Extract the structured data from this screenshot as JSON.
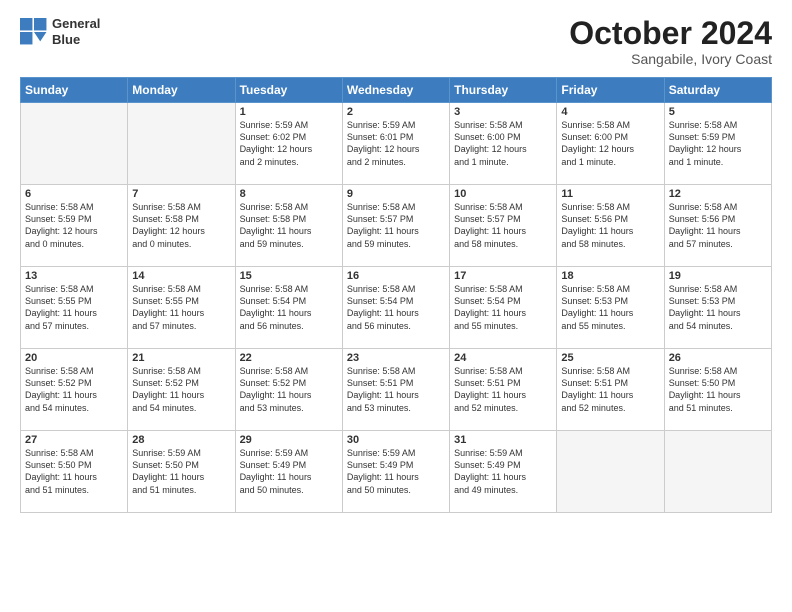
{
  "header": {
    "logo_line1": "General",
    "logo_line2": "Blue",
    "month_title": "October 2024",
    "subtitle": "Sangabile, Ivory Coast"
  },
  "weekdays": [
    "Sunday",
    "Monday",
    "Tuesday",
    "Wednesday",
    "Thursday",
    "Friday",
    "Saturday"
  ],
  "weeks": [
    [
      {
        "day": "",
        "info": ""
      },
      {
        "day": "",
        "info": ""
      },
      {
        "day": "1",
        "info": "Sunrise: 5:59 AM\nSunset: 6:02 PM\nDaylight: 12 hours\nand 2 minutes."
      },
      {
        "day": "2",
        "info": "Sunrise: 5:59 AM\nSunset: 6:01 PM\nDaylight: 12 hours\nand 2 minutes."
      },
      {
        "day": "3",
        "info": "Sunrise: 5:58 AM\nSunset: 6:00 PM\nDaylight: 12 hours\nand 1 minute."
      },
      {
        "day": "4",
        "info": "Sunrise: 5:58 AM\nSunset: 6:00 PM\nDaylight: 12 hours\nand 1 minute."
      },
      {
        "day": "5",
        "info": "Sunrise: 5:58 AM\nSunset: 5:59 PM\nDaylight: 12 hours\nand 1 minute."
      }
    ],
    [
      {
        "day": "6",
        "info": "Sunrise: 5:58 AM\nSunset: 5:59 PM\nDaylight: 12 hours\nand 0 minutes."
      },
      {
        "day": "7",
        "info": "Sunrise: 5:58 AM\nSunset: 5:58 PM\nDaylight: 12 hours\nand 0 minutes."
      },
      {
        "day": "8",
        "info": "Sunrise: 5:58 AM\nSunset: 5:58 PM\nDaylight: 11 hours\nand 59 minutes."
      },
      {
        "day": "9",
        "info": "Sunrise: 5:58 AM\nSunset: 5:57 PM\nDaylight: 11 hours\nand 59 minutes."
      },
      {
        "day": "10",
        "info": "Sunrise: 5:58 AM\nSunset: 5:57 PM\nDaylight: 11 hours\nand 58 minutes."
      },
      {
        "day": "11",
        "info": "Sunrise: 5:58 AM\nSunset: 5:56 PM\nDaylight: 11 hours\nand 58 minutes."
      },
      {
        "day": "12",
        "info": "Sunrise: 5:58 AM\nSunset: 5:56 PM\nDaylight: 11 hours\nand 57 minutes."
      }
    ],
    [
      {
        "day": "13",
        "info": "Sunrise: 5:58 AM\nSunset: 5:55 PM\nDaylight: 11 hours\nand 57 minutes."
      },
      {
        "day": "14",
        "info": "Sunrise: 5:58 AM\nSunset: 5:55 PM\nDaylight: 11 hours\nand 57 minutes."
      },
      {
        "day": "15",
        "info": "Sunrise: 5:58 AM\nSunset: 5:54 PM\nDaylight: 11 hours\nand 56 minutes."
      },
      {
        "day": "16",
        "info": "Sunrise: 5:58 AM\nSunset: 5:54 PM\nDaylight: 11 hours\nand 56 minutes."
      },
      {
        "day": "17",
        "info": "Sunrise: 5:58 AM\nSunset: 5:54 PM\nDaylight: 11 hours\nand 55 minutes."
      },
      {
        "day": "18",
        "info": "Sunrise: 5:58 AM\nSunset: 5:53 PM\nDaylight: 11 hours\nand 55 minutes."
      },
      {
        "day": "19",
        "info": "Sunrise: 5:58 AM\nSunset: 5:53 PM\nDaylight: 11 hours\nand 54 minutes."
      }
    ],
    [
      {
        "day": "20",
        "info": "Sunrise: 5:58 AM\nSunset: 5:52 PM\nDaylight: 11 hours\nand 54 minutes."
      },
      {
        "day": "21",
        "info": "Sunrise: 5:58 AM\nSunset: 5:52 PM\nDaylight: 11 hours\nand 54 minutes."
      },
      {
        "day": "22",
        "info": "Sunrise: 5:58 AM\nSunset: 5:52 PM\nDaylight: 11 hours\nand 53 minutes."
      },
      {
        "day": "23",
        "info": "Sunrise: 5:58 AM\nSunset: 5:51 PM\nDaylight: 11 hours\nand 53 minutes."
      },
      {
        "day": "24",
        "info": "Sunrise: 5:58 AM\nSunset: 5:51 PM\nDaylight: 11 hours\nand 52 minutes."
      },
      {
        "day": "25",
        "info": "Sunrise: 5:58 AM\nSunset: 5:51 PM\nDaylight: 11 hours\nand 52 minutes."
      },
      {
        "day": "26",
        "info": "Sunrise: 5:58 AM\nSunset: 5:50 PM\nDaylight: 11 hours\nand 51 minutes."
      }
    ],
    [
      {
        "day": "27",
        "info": "Sunrise: 5:58 AM\nSunset: 5:50 PM\nDaylight: 11 hours\nand 51 minutes."
      },
      {
        "day": "28",
        "info": "Sunrise: 5:59 AM\nSunset: 5:50 PM\nDaylight: 11 hours\nand 51 minutes."
      },
      {
        "day": "29",
        "info": "Sunrise: 5:59 AM\nSunset: 5:49 PM\nDaylight: 11 hours\nand 50 minutes."
      },
      {
        "day": "30",
        "info": "Sunrise: 5:59 AM\nSunset: 5:49 PM\nDaylight: 11 hours\nand 50 minutes."
      },
      {
        "day": "31",
        "info": "Sunrise: 5:59 AM\nSunset: 5:49 PM\nDaylight: 11 hours\nand 49 minutes."
      },
      {
        "day": "",
        "info": ""
      },
      {
        "day": "",
        "info": ""
      }
    ]
  ]
}
